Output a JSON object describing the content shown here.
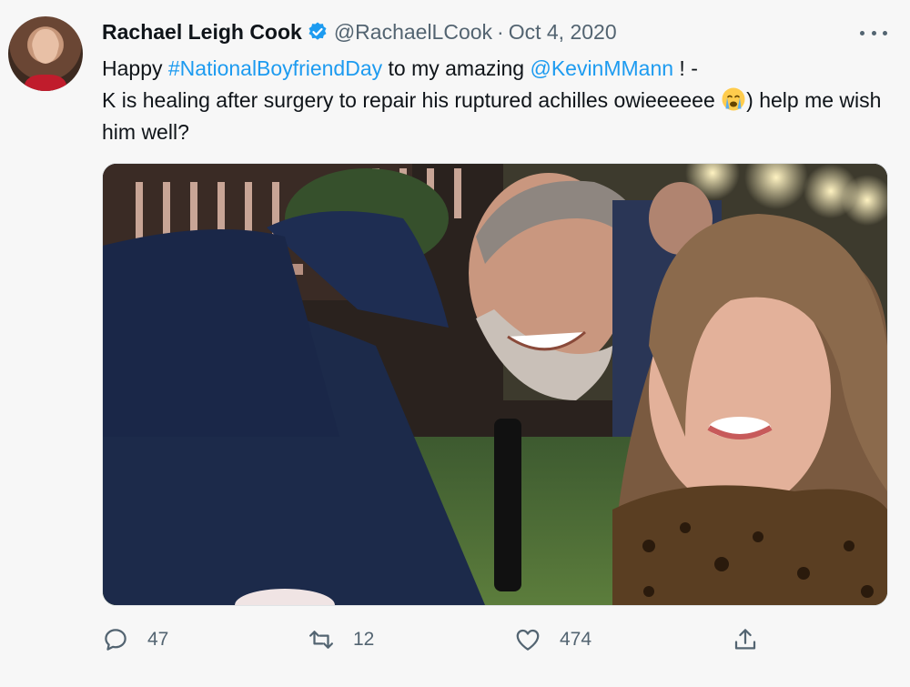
{
  "tweet": {
    "author_name": "Rachael Leigh Cook",
    "handle": "@RachaelLCook",
    "separator": "·",
    "date": "Oct 4, 2020",
    "text": {
      "part1": "Happy ",
      "hashtag": "#NationalBoyfriendDay",
      "part2": " to my amazing ",
      "mention": "@KevinMMann",
      "part3": " ! -",
      "part4": "K is healing after surgery to repair his ruptured achilles owieeeeee ",
      "part5": ") help me wish him well?"
    },
    "emoji": "loudly-crying-face",
    "photo_description_icon": "tweet-photo",
    "colors": {
      "link": "#1d9bf0",
      "verified": "#1d9bf0",
      "secondary": "#536471"
    }
  },
  "actions": {
    "replies": "47",
    "retweets": "12",
    "likes": "474"
  }
}
